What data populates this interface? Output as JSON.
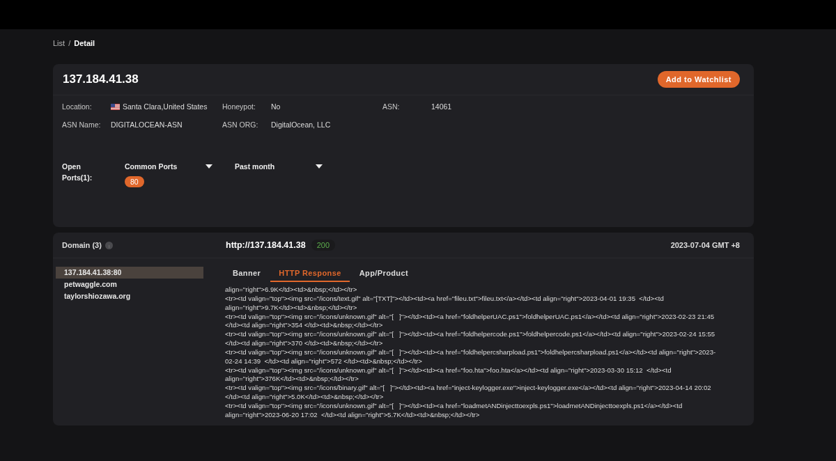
{
  "breadcrumb": {
    "items": [
      "List",
      "Detail"
    ],
    "separator": "/"
  },
  "host": {
    "ip": "137.184.41.38",
    "watch_button": "Add to Watchlist",
    "fields": [
      {
        "label": "Location:",
        "value": "Santa Clara,United States",
        "kind": "flag"
      },
      {
        "label": "Honeypot:",
        "value": "No",
        "kind": "text"
      },
      {
        "label": "ASN:",
        "value": "14061",
        "kind": "text"
      },
      {
        "label": "ASN Name:",
        "value": "DIGITALOCEAN-ASN",
        "kind": "text"
      },
      {
        "label": "ASN ORG:",
        "value": "DigitalOcean, LLC",
        "kind": "text"
      }
    ],
    "open_ports": {
      "label": "Open Ports(1):",
      "filters": [
        "Common Ports",
        "Past month"
      ],
      "ports": [
        "80"
      ]
    }
  },
  "domain_panel": {
    "title": "Domain (3)",
    "url": "http://137.184.41.38",
    "status": "200",
    "date": "2023-07-04 GMT +8",
    "domains": [
      {
        "name": "137.184.41.38:80",
        "selected": true
      },
      {
        "name": "petwaggle.com",
        "selected": false
      },
      {
        "name": "taylorshiozawa.org",
        "selected": false
      }
    ],
    "tabs": [
      {
        "label": "Banner",
        "selected": false
      },
      {
        "label": "HTTP Response",
        "selected": true
      },
      {
        "label": "App/Product",
        "selected": false
      }
    ],
    "response_lines": [
      "align=\"right\">6.9K</td><td>&nbsp;</td></tr>",
      "<tr><td valign=\"top\"><img src=\"/icons/text.gif\" alt=\"[TXT]\"></td><td><a href=\"fileu.txt\">fileu.txt</a></td><td align=\"right\">2023-04-01 19:35  </td><td",
      "align=\"right\">9.7K</td><td>&nbsp;</td></tr>",
      "<tr><td valign=\"top\"><img src=\"/icons/unknown.gif\" alt=\"[   ]\"></td><td><a href=\"foldhelperUAC.ps1\">foldhelperUAC.ps1</a></td><td align=\"right\">2023-02-23 21:45",
      "</td><td align=\"right\">354 </td><td>&nbsp;</td></tr>",
      "<tr><td valign=\"top\"><img src=\"/icons/unknown.gif\" alt=\"[   ]\"></td><td><a href=\"foldhelpercode.ps1\">foldhelpercode.ps1</a></td><td align=\"right\">2023-02-24 15:55",
      "</td><td align=\"right\">370 </td><td>&nbsp;</td></tr>",
      "<tr><td valign=\"top\"><img src=\"/icons/unknown.gif\" alt=\"[   ]\"></td><td><a href=\"foldhelpercsharpload.ps1\">foldhelpercsharpload.ps1</a></td><td align=\"right\">2023-",
      "02-24 14:39  </td><td align=\"right\">572 </td><td>&nbsp;</td></tr>",
      "<tr><td valign=\"top\"><img src=\"/icons/unknown.gif\" alt=\"[   ]\"></td><td><a href=\"foo.hta\">foo.hta</a></td><td align=\"right\">2023-03-30 15:12  </td><td",
      "align=\"right\">376K</td><td>&nbsp;</td></tr>",
      "<tr><td valign=\"top\"><img src=\"/icons/binary.gif\" alt=\"[   ]\"></td><td><a href=\"inject-keylogger.exe\">inject-keylogger.exe</a></td><td align=\"right\">2023-04-14 20:02",
      "</td><td align=\"right\">5.0K</td><td>&nbsp;</td></tr>",
      "<tr><td valign=\"top\"><img src=\"/icons/unknown.gif\" alt=\"[   ]\"></td><td><a href=\"loadmetANDinjecttoexpls.ps1\">loadmetANDinjecttoexpls.ps1</a></td><td",
      "align=\"right\">2023-06-20 17:02  </td><td align=\"right\">5.7K</td><td>&nbsp;</td></tr>"
    ]
  }
}
